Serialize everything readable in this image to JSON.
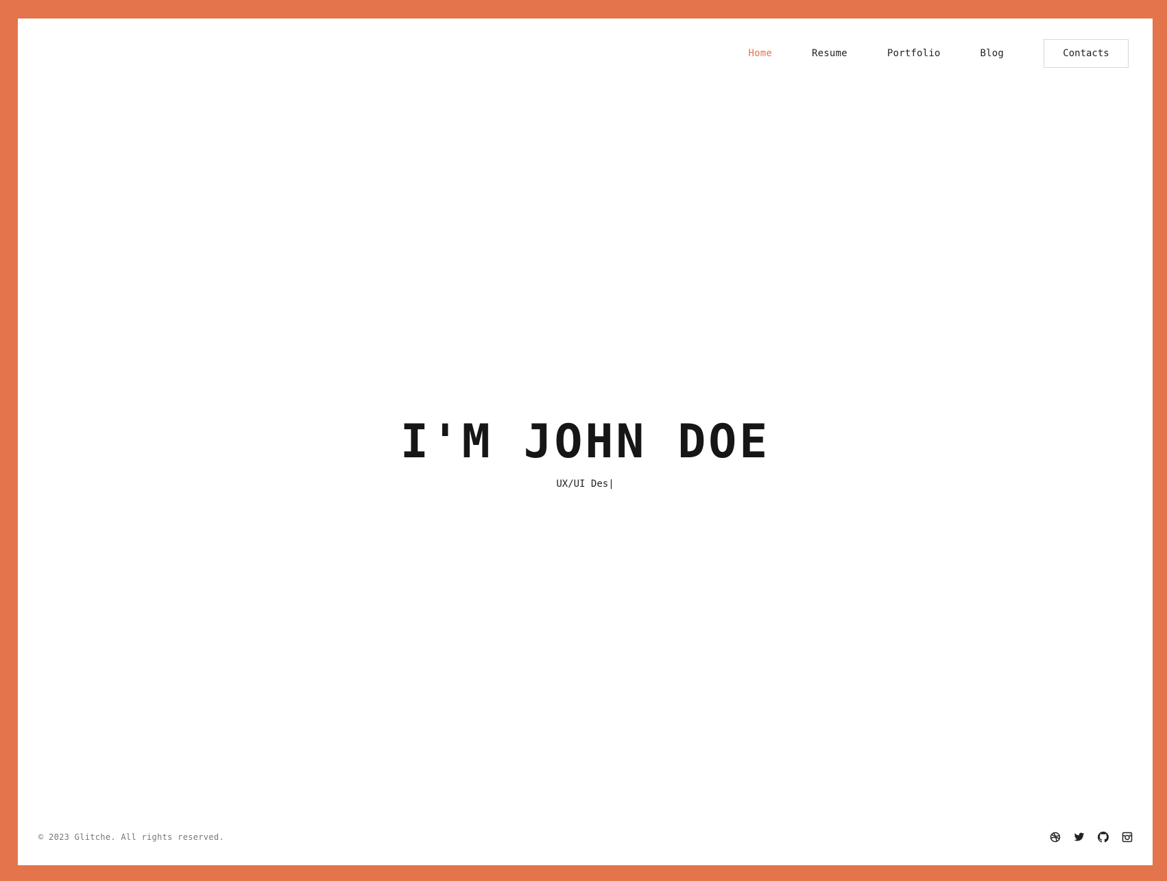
{
  "colors": {
    "accent": "#e4744b",
    "text": "#161616",
    "muted": "#777777"
  },
  "nav": {
    "items": [
      {
        "label": "Home",
        "active": true
      },
      {
        "label": "Resume"
      },
      {
        "label": "Portfolio"
      },
      {
        "label": "Blog"
      }
    ],
    "contacts_label": "Contacts"
  },
  "hero": {
    "title": "I'M JOHN DOE",
    "subtitle": "UX/UI Des|"
  },
  "footer": {
    "copyright": "© 2023 Glitche. All rights reserved.",
    "socials": [
      "dribbble-icon",
      "twitter-icon",
      "github-icon",
      "instagram-icon"
    ]
  }
}
